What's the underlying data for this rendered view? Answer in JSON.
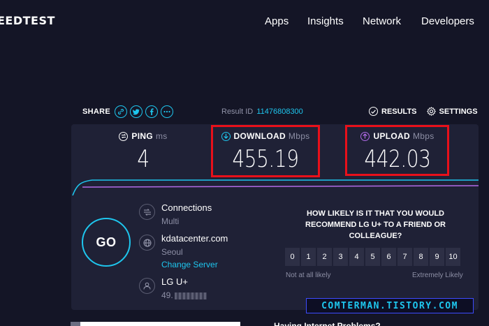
{
  "nav": {
    "logo": "EEDTEST",
    "items": [
      "Apps",
      "Insights",
      "Network",
      "Developers"
    ]
  },
  "share": {
    "label": "SHARE",
    "buttons": [
      {
        "name": "link-icon",
        "glyph": "🔗"
      },
      {
        "name": "twitter-icon",
        "glyph": "t"
      },
      {
        "name": "facebook-icon",
        "glyph": "f"
      },
      {
        "name": "more-icon",
        "glyph": "•••"
      }
    ]
  },
  "result": {
    "label": "Result ID",
    "id": "11476808300"
  },
  "links": {
    "results": "RESULTS",
    "settings": "SETTINGS"
  },
  "metrics": {
    "ping": {
      "label": "PING",
      "unit": "ms",
      "value": "4"
    },
    "download": {
      "label": "DOWNLOAD",
      "unit": "Mbps",
      "value": "455.19"
    },
    "upload": {
      "label": "UPLOAD",
      "unit": "Mbps",
      "value": "442.03"
    }
  },
  "go": "GO",
  "connections": {
    "title": "Connections",
    "value": "Multi"
  },
  "server": {
    "host": "kdatacenter.com",
    "city": "Seoul",
    "change": "Change Server"
  },
  "isp": {
    "name": "LG U+",
    "ip_prefix": "49."
  },
  "survey": {
    "question": "HOW LIKELY IS IT THAT YOU WOULD RECOMMEND LG U+ TO A FRIEND OR COLLEAGUE?",
    "scale": [
      "0",
      "1",
      "2",
      "3",
      "4",
      "5",
      "6",
      "7",
      "8",
      "9",
      "10"
    ],
    "low_label": "Not at all likely",
    "high_label": "Extremely Likely"
  },
  "watermark": "COMTERMAN.TISTORY.COM",
  "bottom_text": "Having Internet Problems?",
  "colors": {
    "accent": "#1ec6ee",
    "upload": "#b26be8",
    "highlight": "#e8101a"
  }
}
